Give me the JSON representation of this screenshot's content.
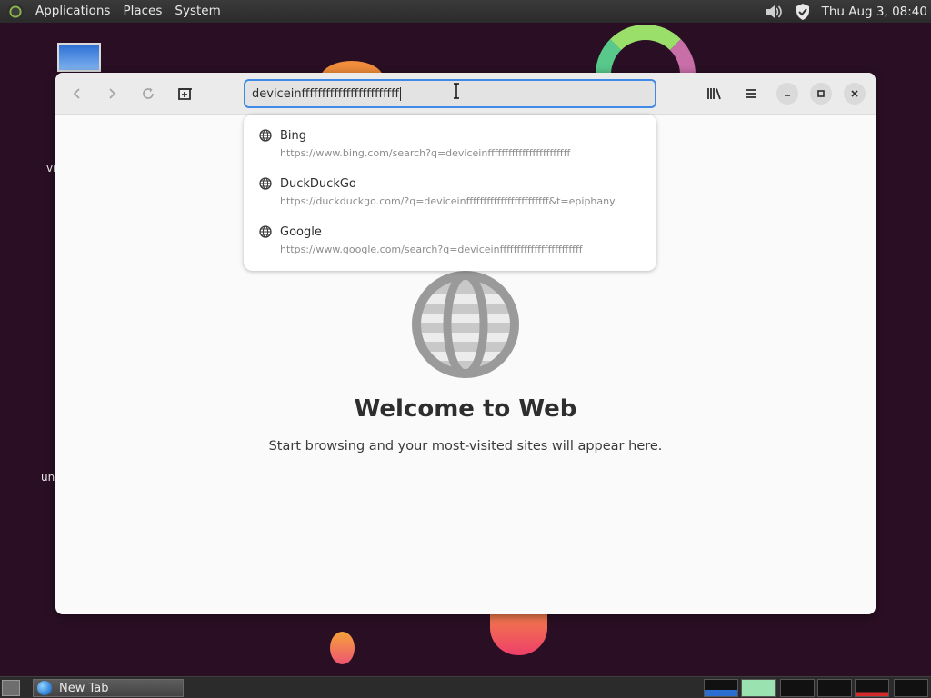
{
  "top_panel": {
    "menus": [
      "Applications",
      "Places",
      "System"
    ],
    "clock": "Thu Aug  3, 08:40"
  },
  "desktop": {
    "icon_labels": [
      "vm",
      "un"
    ]
  },
  "browser": {
    "url_text": "deviceinffffffffffffffffffffffff",
    "suggestions": [
      {
        "name": "Bing",
        "url": "https://www.bing.com/search?q=deviceinffffffffffffffffffffffff"
      },
      {
        "name": "DuckDuckGo",
        "url": "https://duckduckgo.com/?q=deviceinffffffffffffffffffffffff&t=epiphany"
      },
      {
        "name": "Google",
        "url": "https://www.google.com/search?q=deviceinffffffffffffffffffffffff"
      }
    ],
    "welcome_title": "Welcome to Web",
    "welcome_subtitle": "Start browsing and your most-visited sites will appear here."
  },
  "taskbar": {
    "task_label": "New Tab"
  },
  "colors": {
    "accent": "#3f8ae5",
    "desktop_bg": "#2a0f24"
  },
  "icons": [
    "back-icon",
    "forward-icon",
    "reload-icon",
    "new-tab-icon",
    "library-icon",
    "menu-icon",
    "minimize-icon",
    "maximize-icon",
    "close-icon",
    "globe-icon",
    "volume-icon",
    "shield-icon"
  ]
}
